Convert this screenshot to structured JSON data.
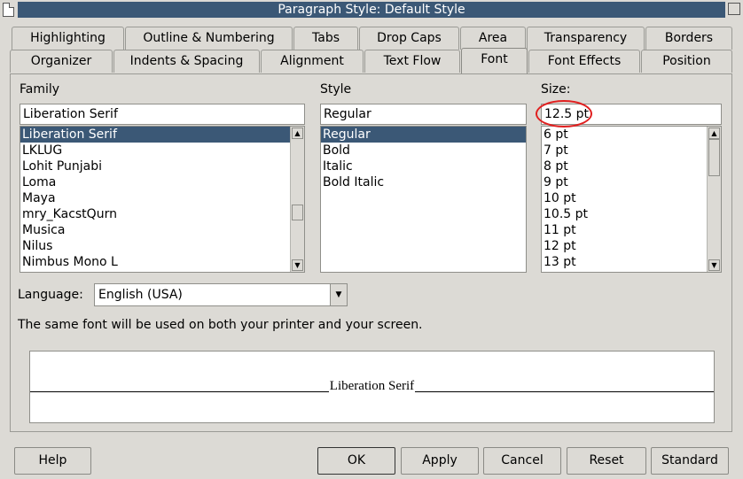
{
  "window": {
    "title": "Paragraph Style: Default Style",
    "doc_icon": "document-icon",
    "close_icon": "close-icon"
  },
  "tabs_row1": [
    "Highlighting",
    "Outline & Numbering",
    "Tabs",
    "Drop Caps",
    "Area",
    "Transparency",
    "Borders"
  ],
  "tabs_row2": [
    "Organizer",
    "Indents & Spacing",
    "Alignment",
    "Text Flow",
    "Font",
    "Font Effects",
    "Position"
  ],
  "active_tab": "Font",
  "family": {
    "label": "Family",
    "value": "Liberation Serif",
    "items": [
      "Liberation Serif",
      "LKLUG",
      "Lohit Punjabi",
      "Loma",
      "Maya",
      "mry_KacstQurn",
      "Musica",
      "Nilus",
      "Nimbus Mono L"
    ],
    "selected": 0
  },
  "style": {
    "label": "Style",
    "value": "Regular",
    "items": [
      "Regular",
      "Bold",
      "Italic",
      "Bold Italic"
    ],
    "selected": 0
  },
  "size": {
    "label": "Size:",
    "value": "12.5 pt",
    "items": [
      "6 pt",
      "7 pt",
      "8 pt",
      "9 pt",
      "10 pt",
      "10.5 pt",
      "11 pt",
      "12 pt",
      "13 pt"
    ],
    "selected": -1
  },
  "language": {
    "label": "Language:",
    "value": "English (USA)",
    "dropdown_icon": "chevron-down-icon"
  },
  "info_text": "The same font will be used on both your printer and your screen.",
  "preview_text": "Liberation Serif",
  "buttons": {
    "help": "Help",
    "ok": "OK",
    "apply": "Apply",
    "cancel": "Cancel",
    "reset": "Reset",
    "standard": "Standard"
  },
  "annotation_color": "#e02020"
}
